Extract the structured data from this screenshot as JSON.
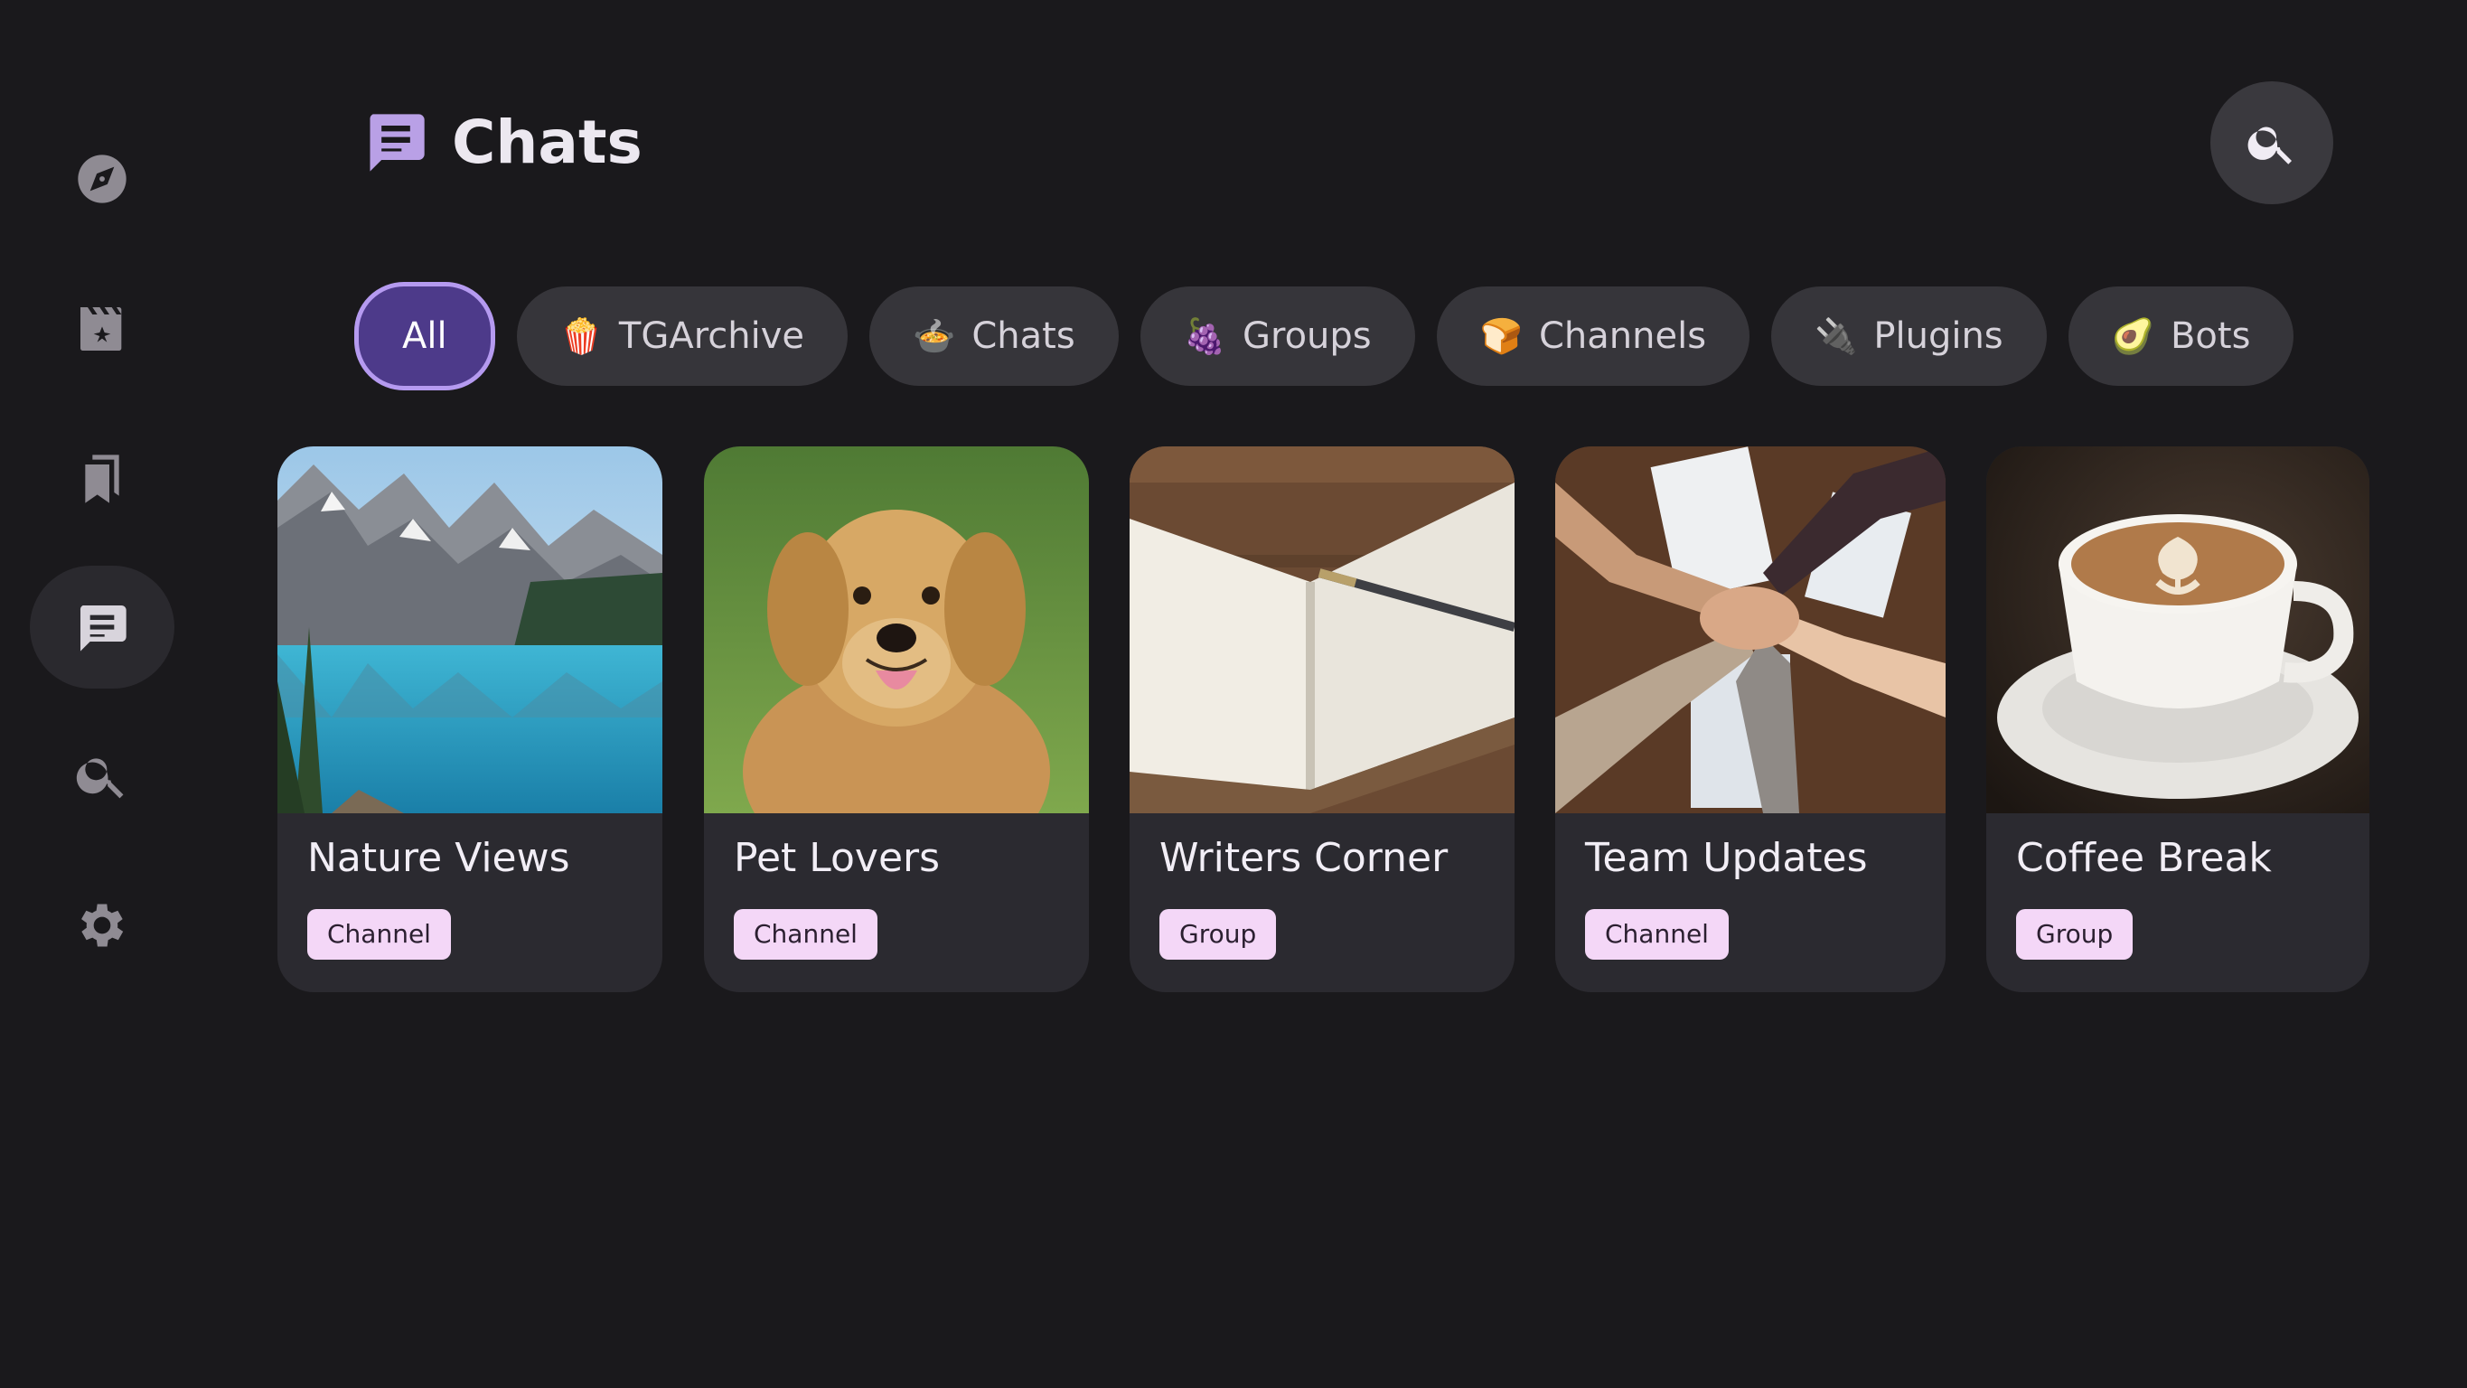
{
  "header": {
    "title": "Chats",
    "title_icon": "chat-icon",
    "search_icon": "search-icon"
  },
  "sidebar": {
    "items": [
      {
        "name": "explore",
        "icon": "compass-icon",
        "active": false
      },
      {
        "name": "media",
        "icon": "clapperboard-icon",
        "active": false
      },
      {
        "name": "saved",
        "icon": "bookmark-icon",
        "active": false
      },
      {
        "name": "chats",
        "icon": "chat-icon",
        "active": true
      },
      {
        "name": "search",
        "icon": "search-icon",
        "active": false
      },
      {
        "name": "settings",
        "icon": "gear-icon",
        "active": false
      }
    ]
  },
  "filters": {
    "selected": "All",
    "chips": [
      {
        "label": "All",
        "emoji": ""
      },
      {
        "label": "TGArchive",
        "emoji": "🍿"
      },
      {
        "label": "Chats",
        "emoji": "🍲"
      },
      {
        "label": "Groups",
        "emoji": "🍇"
      },
      {
        "label": "Channels",
        "emoji": "🍞"
      },
      {
        "label": "Plugins",
        "emoji": "🔌"
      },
      {
        "label": "Bots",
        "emoji": "🥑"
      }
    ]
  },
  "cards": [
    {
      "title": "Nature Views",
      "badge": "Channel",
      "image": "mountain-lake-photo"
    },
    {
      "title": "Pet Lovers",
      "badge": "Channel",
      "image": "golden-retriever-photo"
    },
    {
      "title": "Writers Corner",
      "badge": "Group",
      "image": "notebook-pen-photo"
    },
    {
      "title": "Team Updates",
      "badge": "Channel",
      "image": "team-hands-photo"
    },
    {
      "title": "Coffee Break",
      "badge": "Group",
      "image": "coffee-cup-photo"
    }
  ],
  "colors": {
    "background": "#1a191c",
    "accent": "#b59af0",
    "selected_chip": "#4d3a8a",
    "chip": "#36353a",
    "card": "#2b2a30",
    "badge": "#f4d7f7"
  }
}
